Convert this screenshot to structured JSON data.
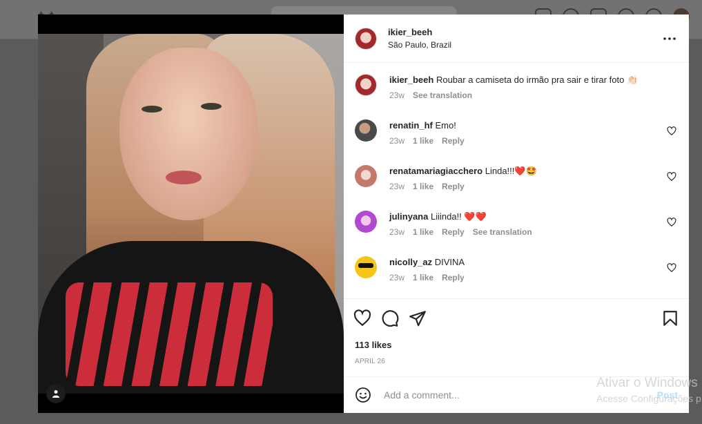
{
  "post": {
    "author": {
      "username": "ikier_beeh",
      "location": "São Paulo, Brazil"
    },
    "caption": {
      "username": "ikier_beeh",
      "text": "Roubar a camiseta do irmão pra sair e tirar foto 👏🏻",
      "time": "23w",
      "translation_label": "See translation"
    },
    "comments": [
      {
        "username": "renatin_hf",
        "text": "Emo!",
        "time": "23w",
        "likes": "1 like",
        "reply": "Reply"
      },
      {
        "username": "renatamariagiacchero",
        "text": "Linda!!!❤️🤩",
        "time": "23w",
        "likes": "1 like",
        "reply": "Reply"
      },
      {
        "username": "julinyana",
        "text": "Liiinda!! ❤️❤️",
        "time": "23w",
        "likes": "1 like",
        "reply": "Reply",
        "translation_label": "See translation"
      },
      {
        "username": "nicolly_az",
        "text": "DIVINA",
        "time": "23w",
        "likes": "1 like",
        "reply": "Reply"
      }
    ],
    "likes_label": "113 likes",
    "date_label": "APRIL 26",
    "add_comment": {
      "placeholder": "Add a comment...",
      "post_label": "Post"
    }
  },
  "watermark": {
    "line1": "Ativar o Windows",
    "line2": "Acesse Configurações p"
  },
  "icons": [
    "more-icon",
    "heart-icon",
    "comment-icon",
    "share-icon",
    "bookmark-icon",
    "emoji-icon",
    "user-tag-icon"
  ],
  "colors": {
    "link_post": "#b2dffc",
    "text": "#262626",
    "muted": "#8e8e8e",
    "overlay": "#5b5b5b"
  }
}
